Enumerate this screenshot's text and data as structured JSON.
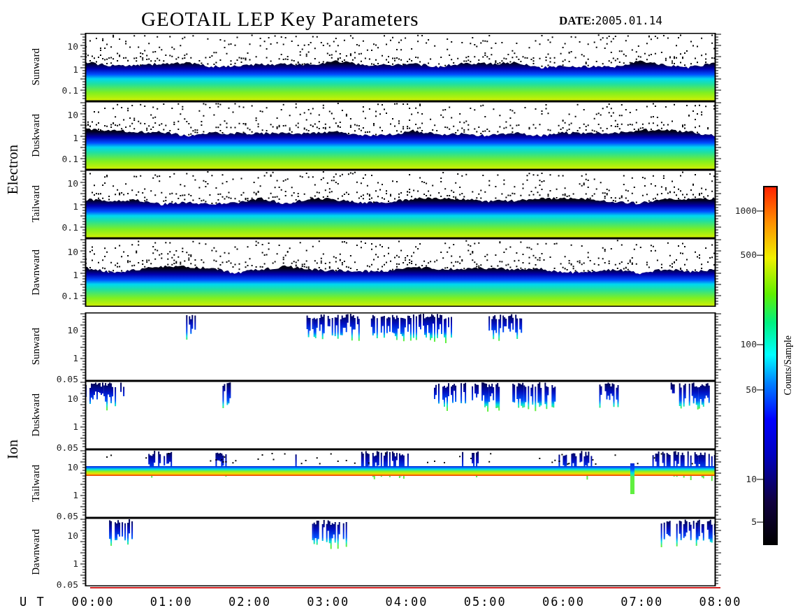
{
  "title": "GEOTAIL LEP Key Parameters",
  "date": {
    "label": "DATE:",
    "value": "2005.01.14"
  },
  "groups": [
    {
      "label": "Electron",
      "panels": [
        {
          "direction": "Sunward",
          "kind": "dense",
          "yticks": [
            "10",
            "1",
            "0.1"
          ]
        },
        {
          "direction": "Duskward",
          "kind": "dense",
          "yticks": [
            "10",
            "1",
            "0.1"
          ]
        },
        {
          "direction": "Tailward",
          "kind": "dense",
          "yticks": [
            "10",
            "1",
            "0.1"
          ]
        },
        {
          "direction": "Dawnward",
          "kind": "dense",
          "yticks": [
            "10",
            "1",
            "0.1"
          ]
        }
      ]
    },
    {
      "label": "Ion",
      "panels": [
        {
          "direction": "Sunward",
          "kind": "sparse",
          "yticks": [
            "10",
            "1",
            "0.05"
          ]
        },
        {
          "direction": "Duskward",
          "kind": "sparse",
          "yticks": [
            "10",
            "1",
            "0.05"
          ]
        },
        {
          "direction": "Tailward",
          "kind": "band",
          "yticks": [
            "10",
            "1",
            "0.05"
          ]
        },
        {
          "direction": "Dawnward",
          "kind": "sparse",
          "yticks": [
            "10",
            "1",
            "0.05"
          ]
        }
      ]
    }
  ],
  "colorbar": {
    "label": "Counts/Sample",
    "ticks": [
      "1000",
      "500",
      "100",
      "50",
      "10",
      "5"
    ]
  },
  "time_axis": {
    "label": "U T",
    "ticks": [
      "00:00",
      "01:00",
      "02:00",
      "03:00",
      "04:00",
      "05:00",
      "06:00",
      "07:00",
      "08:00"
    ]
  }
}
